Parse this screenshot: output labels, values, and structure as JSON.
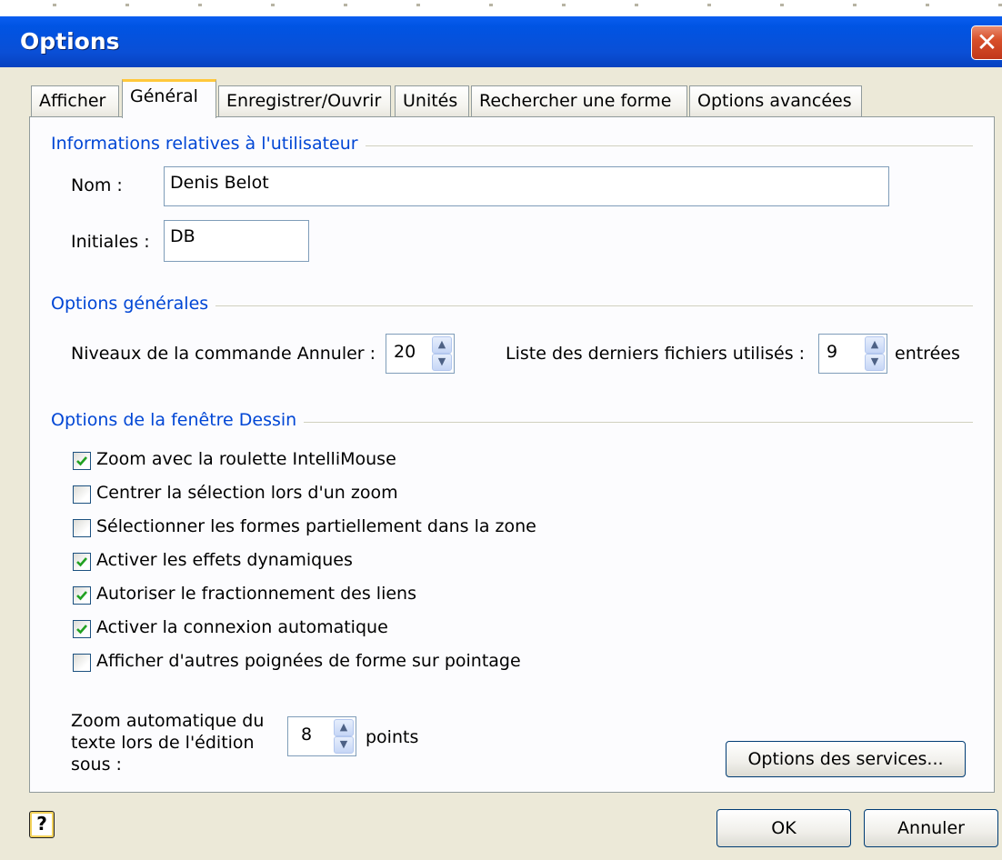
{
  "window": {
    "title": "Options",
    "close_glyph": "✕"
  },
  "tabs": [
    {
      "label": "Afficher"
    },
    {
      "label": "Général",
      "active": true
    },
    {
      "label": "Enregistrer/Ouvrir"
    },
    {
      "label": "Unités"
    },
    {
      "label": "Rechercher une forme"
    },
    {
      "label": "Options avancées"
    }
  ],
  "user_info": {
    "title": "Informations relatives à l'utilisateur",
    "name_label": "Nom :",
    "name_value": "Denis Belot",
    "initials_label": "Initiales :",
    "initials_value": "DB"
  },
  "general": {
    "title": "Options générales",
    "undo_label": "Niveaux de la commande Annuler :",
    "undo_value": "20",
    "recent_label": "Liste des derniers fichiers utilisés :",
    "recent_value": "9",
    "recent_suffix": "entrées"
  },
  "drawing": {
    "title": "Options de la fenêtre Dessin",
    "checkboxes": [
      {
        "label": "Zoom avec la roulette IntelliMouse",
        "checked": true
      },
      {
        "label": "Centrer la sélection lors d'un zoom",
        "checked": false
      },
      {
        "label": "Sélectionner les formes partiellement dans la zone",
        "checked": false
      },
      {
        "label": "Activer les effets dynamiques",
        "checked": true
      },
      {
        "label": "Autoriser le fractionnement des liens",
        "checked": true
      },
      {
        "label": "Activer la connexion automatique",
        "checked": true
      },
      {
        "label": "Afficher d'autres poignées de forme sur pointage",
        "checked": false
      }
    ],
    "zoom_label_lines": [
      "Zoom automatique du",
      "texte lors de l'édition",
      "sous :"
    ],
    "zoom_value": "8",
    "zoom_suffix": "points",
    "services_button": "Options des services..."
  },
  "footer": {
    "help_glyph": "?",
    "ok_label": "OK",
    "cancel_label": "Annuler"
  },
  "colors": {
    "title_bar": "#0054e3",
    "group_title": "#0046d5",
    "checkmark": "#21a121",
    "active_tab_accent": "#ffc83c"
  }
}
